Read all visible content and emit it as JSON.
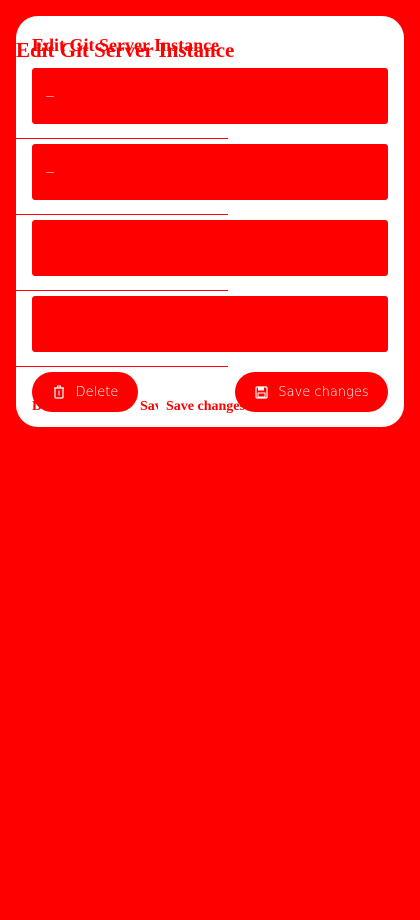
{
  "dialog": {
    "title": "Edit Git Server Instance"
  },
  "fields": [
    {
      "id": "field-1",
      "value": "",
      "placeholder": ""
    },
    {
      "id": "field-2",
      "value": "",
      "placeholder": ""
    },
    {
      "id": "field-3",
      "value": "",
      "placeholder": ""
    },
    {
      "id": "field-4",
      "value": "",
      "placeholder": ""
    }
  ],
  "actions": {
    "delete_label": "Delete",
    "save_label": "Save changes"
  },
  "colors": {
    "background": "#ff0000",
    "surface": "#ffffff",
    "accent": "#ff0000",
    "on_accent": "#ffffff"
  },
  "icons": {
    "delete": "trash-icon",
    "save": "save-icon"
  }
}
